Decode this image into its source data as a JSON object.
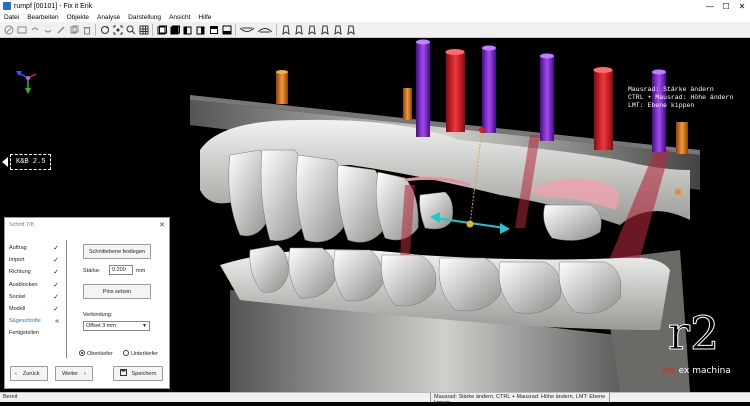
{
  "window": {
    "title": "rumpf [00101] - Fix it Erik",
    "minimize": "—",
    "maximize": "☐",
    "close": "✕"
  },
  "menu": [
    "Datei",
    "Bearbeiten",
    "Objekte",
    "Analyse",
    "Darstellung",
    "Ansicht",
    "Hilfe"
  ],
  "toolbar": {
    "icons": [
      "new-icon",
      "open-icon",
      "undo-icon",
      "redo-icon",
      "pencil-icon",
      "copy-icon",
      "trash-icon",
      "rotate-icon",
      "zoom-fit-icon",
      "zoom-icon",
      "grid-icon",
      "view-front-icon",
      "view-back-icon",
      "view-left-icon",
      "view-right-icon",
      "view-top-icon",
      "view-bottom-icon",
      "jaw-upper-icon",
      "jaw-lower-icon",
      "tooth-1-icon",
      "tooth-2-icon",
      "tooth-3-icon",
      "tooth-4-icon",
      "tooth-5-icon",
      "tooth-6-icon"
    ]
  },
  "viewport": {
    "hint_lines": "Mausrad: Stärke ändern\nCTRL + Mausrad: Höhe ändern\nLMT: Ebene kippen",
    "ksb_label": "K&B 2.5"
  },
  "wizard": {
    "title": "Schritt 7/8",
    "close": "✕",
    "steps": [
      {
        "label": "Auftrag",
        "mark": "✓"
      },
      {
        "label": "Import",
        "mark": "✓"
      },
      {
        "label": "Richtung",
        "mark": "✓"
      },
      {
        "label": "Ausblocken",
        "mark": "✓"
      },
      {
        "label": "Sockel",
        "mark": "✓"
      },
      {
        "label": "Modell",
        "mark": "✓"
      },
      {
        "label": "Sägeschnitte",
        "mark": "«"
      },
      {
        "label": "Fertigstellen",
        "mark": ""
      }
    ],
    "cut_plane_button": "Schnittebene festlegen",
    "strength_label": "Stärke:",
    "strength_value": "0.200",
    "strength_unit": "mm",
    "pins_button": "Pins setzen",
    "connection_label": "Verbindung:",
    "connection_value": "Offset 3 mm",
    "radio_upper": "Oberkiefer",
    "radio_lower": "Unterkiefer",
    "back_button": "Zurück",
    "next_button": "Weiter",
    "save_button": "Speichern"
  },
  "logo": {
    "mark": "r2",
    "sub_prefix": "dei",
    "sub_rest": " ex machina"
  },
  "status": {
    "left": "Bereit",
    "middle": "Mausrad: Stärke ändern, CTRL + Mausrad: Höhe ändern, LMT: Ebene kippen"
  },
  "colors": {
    "accent": "#2a6fb2",
    "pin_purple": "#7a1fc0",
    "pin_red": "#d4161b",
    "pin_orange": "#d86a10",
    "gauge_cyan": "#1ec8d0"
  }
}
